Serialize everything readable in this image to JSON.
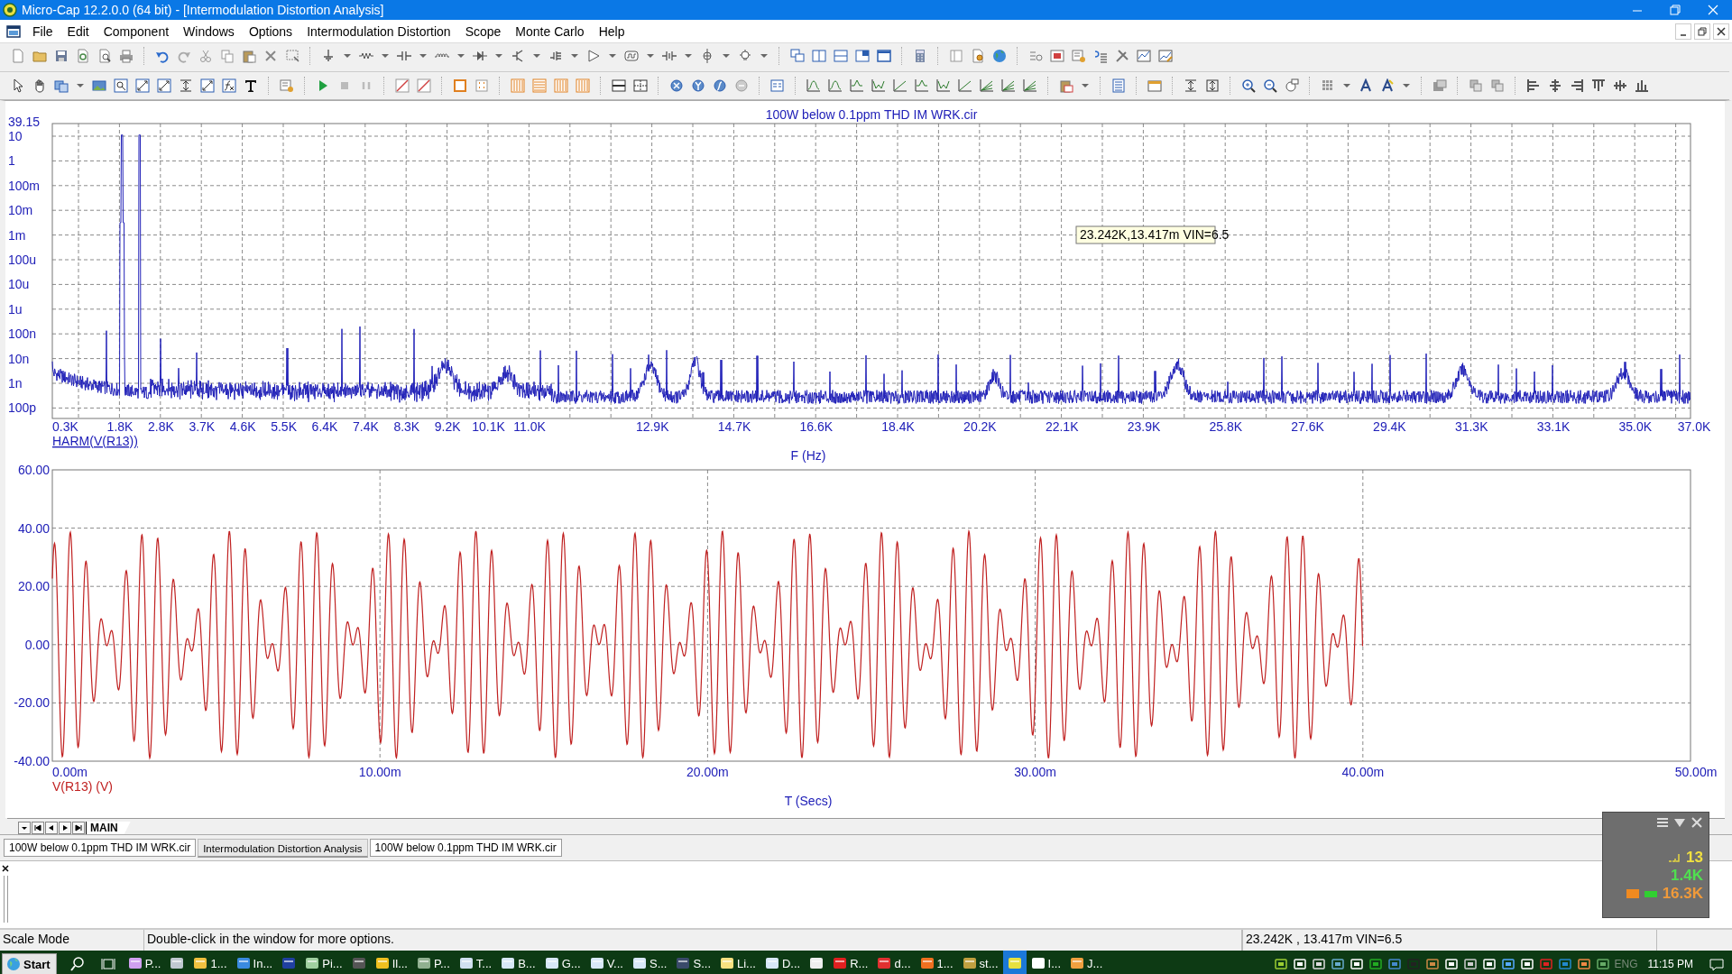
{
  "window": {
    "title": "Micro-Cap 12.2.0.0 (64 bit) - [Intermodulation Distortion Analysis]"
  },
  "menu": [
    "File",
    "Edit",
    "Component",
    "Windows",
    "Options",
    "Intermodulation Distortion",
    "Scope",
    "Monte Carlo",
    "Help"
  ],
  "plot": {
    "title": "100W below 0.1ppm THD IM WRK.cir",
    "tooltip": "23.242K,13.417m VIN=6.5",
    "spectrum": {
      "y_tick_labels": [
        "39.15",
        "10",
        "1",
        "100m",
        "10m",
        "1m",
        "100u",
        "10u",
        "1u",
        "100n",
        "10n",
        "1n",
        "100p"
      ],
      "x_tick_labels": [
        "0.3K",
        "1.8K",
        "2.8K",
        "3.7K",
        "4.6K",
        "5.5K",
        "6.4K",
        "7.4K",
        "8.3K",
        "9.2K",
        "10.1K",
        "11.0K",
        "12.9K",
        "14.7K",
        "16.6K",
        "18.4K",
        "20.2K",
        "22.1K",
        "23.9K",
        "25.8K",
        "27.6K",
        "29.4K",
        "31.3K",
        "33.1K",
        "35.0K",
        "37.0K"
      ],
      "trace_label": "HARM(V(R13))",
      "x_axis_title": "F (Hz)"
    },
    "waveform": {
      "y_tick_labels": [
        "60.00",
        "40.00",
        "20.00",
        "0.00",
        "-20.00",
        "-40.00"
      ],
      "x_tick_labels": [
        "0.00m",
        "10.00m",
        "20.00m",
        "30.00m",
        "40.00m",
        "50.00m"
      ],
      "trace_label": "V(R13) (V)",
      "x_axis_title": "T (Secs)"
    }
  },
  "sheet_tab": "MAIN",
  "document_tabs": [
    {
      "label": "100W below 0.1ppm THD IM WRK.cir",
      "selected": false
    },
    {
      "label": "Intermodulation Distortion Analysis",
      "selected": true
    },
    {
      "label": "100W below 0.1ppm THD IM WRK.cir",
      "selected": false
    }
  ],
  "status_bar": [
    "Scale Mode",
    "Double-click in the window for more options.",
    "23.242K , 13.417m VIN=6.5"
  ],
  "monitor_widget": {
    "readings": [
      {
        "value": "13",
        "color": "#f0e040"
      },
      {
        "value": "1.4K",
        "color": "#50e050"
      },
      {
        "value": "16.3K",
        "color": "#f09a3a"
      }
    ]
  },
  "taskbar": {
    "start": "Start",
    "items": [
      {
        "label": "P...",
        "selected": false
      },
      {
        "selected": false
      },
      {
        "label": "1...",
        "selected": false
      },
      {
        "label": "In...",
        "selected": false
      },
      {
        "selected": false
      },
      {
        "label": "Pi...",
        "selected": false
      },
      {
        "selected": false
      },
      {
        "label": "Il...",
        "selected": false
      },
      {
        "label": "P...",
        "selected": false
      },
      {
        "label": "T...",
        "selected": false
      },
      {
        "label": "B...",
        "selected": false
      },
      {
        "label": "G...",
        "selected": false
      },
      {
        "label": "V...",
        "selected": false
      },
      {
        "label": "S...",
        "selected": false
      },
      {
        "label": "S...",
        "selected": false
      },
      {
        "label": "Li...",
        "selected": false
      },
      {
        "label": "D...",
        "selected": false
      },
      {
        "selected": false
      },
      {
        "label": "R...",
        "selected": false
      },
      {
        "label": "d...",
        "selected": false
      },
      {
        "label": "1...",
        "selected": false
      },
      {
        "label": "st...",
        "selected": false
      },
      {
        "selected": true
      },
      {
        "label": "I...",
        "selected": false
      },
      {
        "label": "J...",
        "selected": false
      }
    ],
    "language": "ENG",
    "clock": "11:15 PM"
  }
}
